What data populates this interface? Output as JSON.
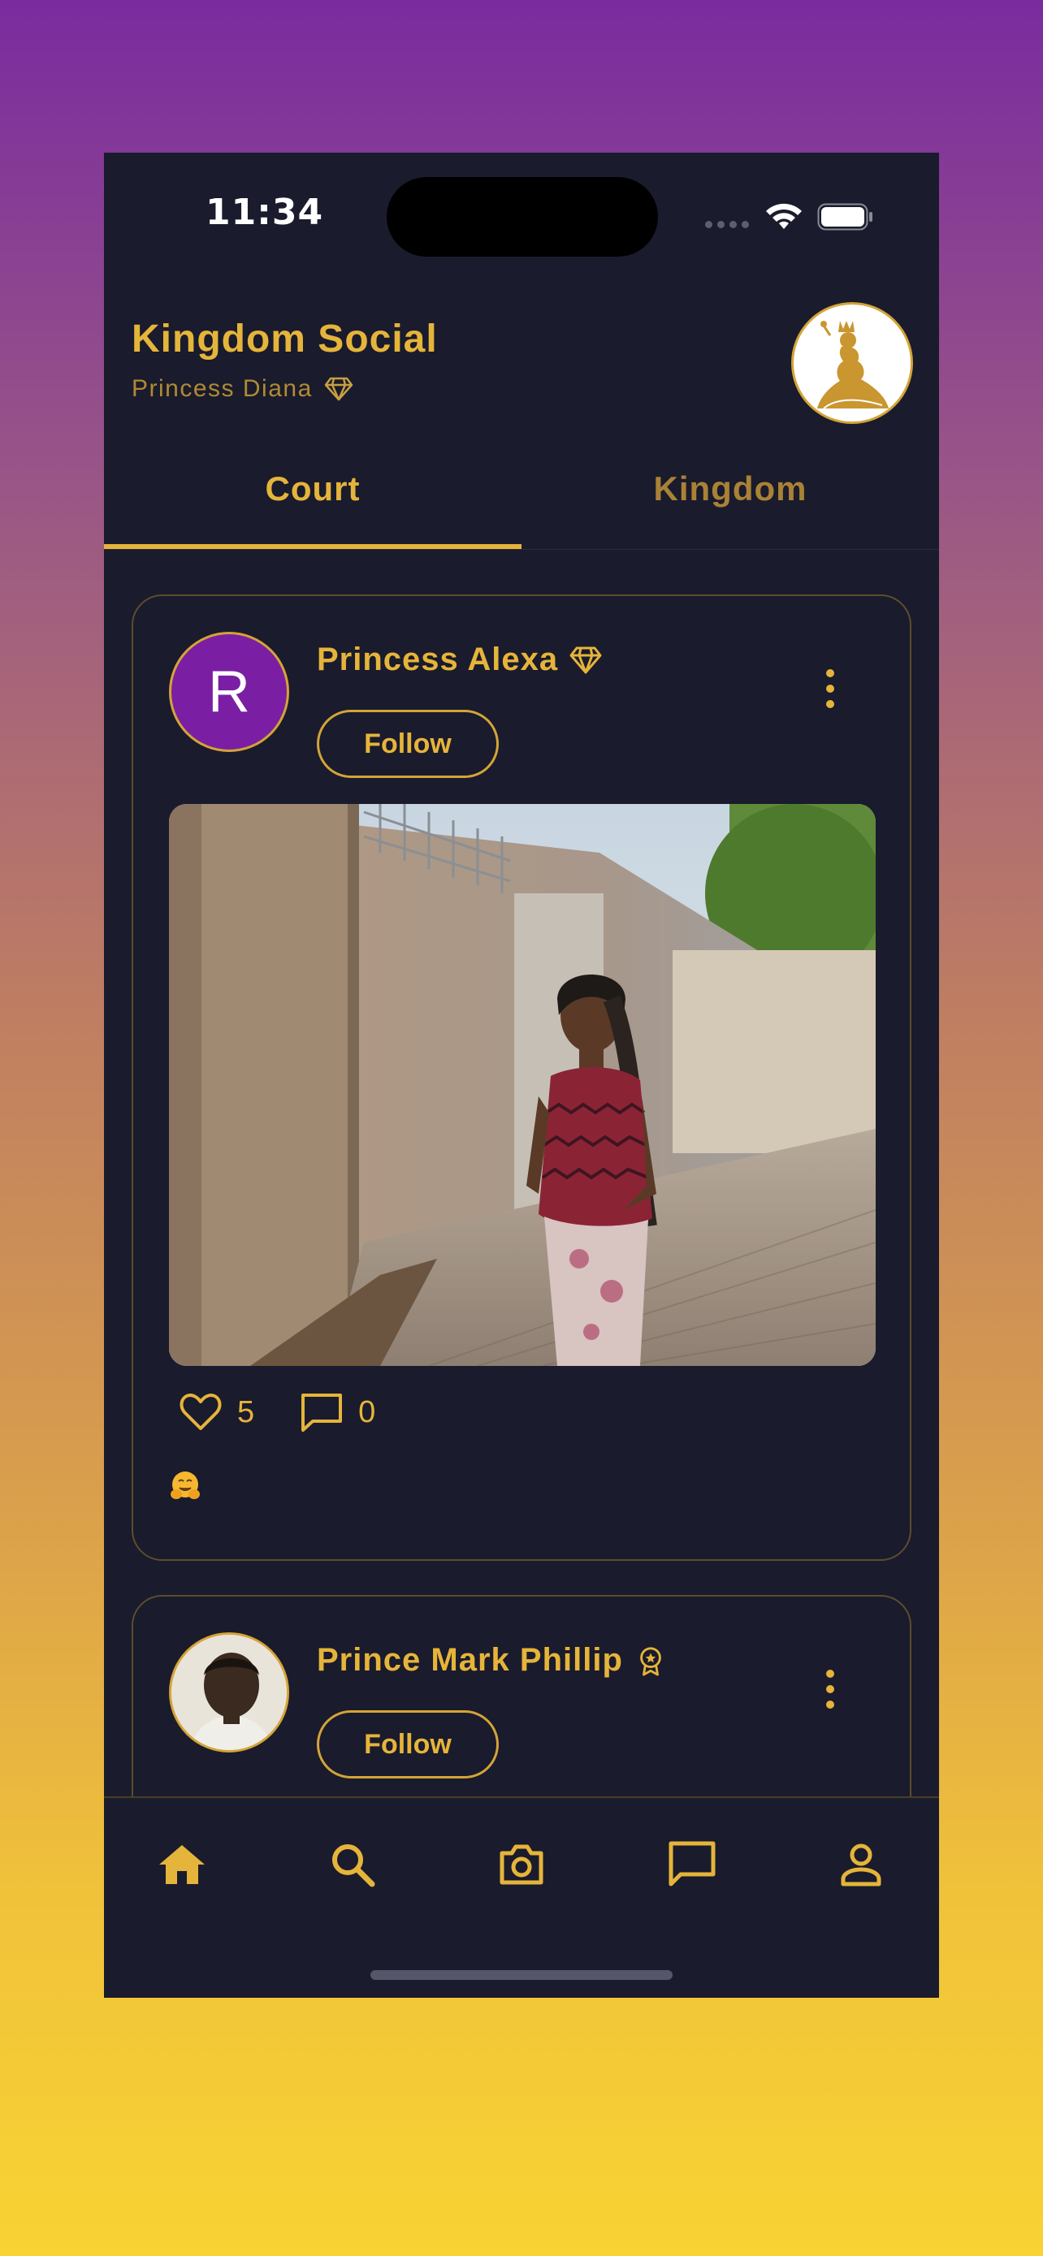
{
  "status_bar": {
    "time": "11:34"
  },
  "header": {
    "title": "Kingdom Social",
    "user_name": "Princess Diana",
    "user_badge_icon": "diamond-icon",
    "logo_icon": "queen-logo-icon"
  },
  "tabs": [
    {
      "label": "Court",
      "active": true
    },
    {
      "label": "Kingdom",
      "active": false
    }
  ],
  "posts": [
    {
      "avatar_initial": "R",
      "author": "Princess Alexa",
      "badge_icon": "diamond-icon",
      "follow_label": "Follow",
      "likes": "5",
      "comments": "0",
      "caption": "🤗"
    },
    {
      "avatar_initial": "",
      "author": "Prince Mark Phillip",
      "badge_icon": "award-icon",
      "follow_label": "Follow"
    }
  ],
  "bottom_nav": [
    {
      "icon": "home-icon",
      "active": true
    },
    {
      "icon": "search-icon",
      "active": false
    },
    {
      "icon": "camera-icon",
      "active": false
    },
    {
      "icon": "chat-icon",
      "active": false
    },
    {
      "icon": "profile-icon",
      "active": false
    }
  ],
  "colors": {
    "accent": "#e5b43a",
    "muted_accent": "#a98236",
    "background": "#1a1b2c",
    "avatar_purple": "#7a1fa3"
  }
}
